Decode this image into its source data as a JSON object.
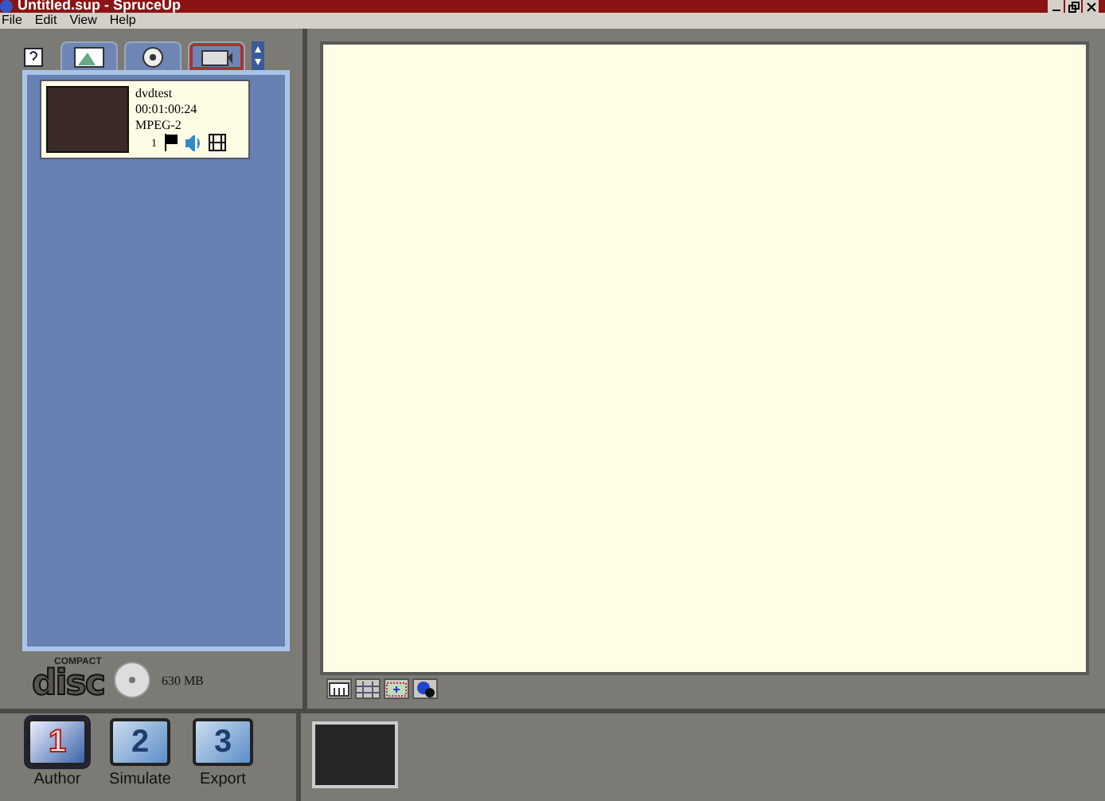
{
  "window": {
    "title": "Untitled.sup - SpruceUp"
  },
  "menu": [
    "File",
    "Edit",
    "View",
    "Help"
  ],
  "tabs": [
    {
      "kind": "picture",
      "selected": false
    },
    {
      "kind": "disc",
      "selected": false
    },
    {
      "kind": "film",
      "selected": true
    }
  ],
  "clips": [
    {
      "name": "dvdtest",
      "duration": "00:01:00:24",
      "format": "MPEG-2",
      "chapter": "1"
    }
  ],
  "disc": {
    "logo_small": "COMPACT",
    "logo": "disc",
    "capacity": "630 MB"
  },
  "view_buttons": [
    {
      "kind": "bars",
      "selected": false
    },
    {
      "kind": "grid",
      "selected": false
    },
    {
      "kind": "frame",
      "selected": false
    },
    {
      "kind": "blob",
      "selected": false
    }
  ],
  "steps": [
    {
      "number": "1",
      "label": "Author",
      "selected": true
    },
    {
      "number": "2",
      "label": "Simulate",
      "selected": false
    },
    {
      "number": "3",
      "label": "Export",
      "selected": false
    }
  ]
}
